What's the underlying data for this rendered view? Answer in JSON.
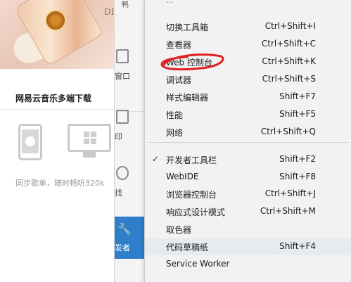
{
  "page": {
    "brand_text": "DI",
    "section_title": "网易云音乐多端下载",
    "sync_text": "同步歌单，随时畅听320k"
  },
  "strip": {
    "top_label": "鸭",
    "items": [
      {
        "label": "窗口",
        "icon": "window-icon"
      },
      {
        "label": "印",
        "icon": "print-icon"
      },
      {
        "label": "找",
        "icon": "search-icon"
      }
    ],
    "active_label": "发者",
    "active_icon": "wrench-icon"
  },
  "menu": {
    "top_text": "...",
    "items": [
      {
        "label": "切换工具箱",
        "shortcut": "Ctrl+Shift+I",
        "checked": false
      },
      {
        "label": "查看器",
        "shortcut": "Ctrl+Shift+C",
        "checked": false
      },
      {
        "label": "Web 控制台",
        "shortcut": "Ctrl+Shift+K",
        "checked": false,
        "annotated": true
      },
      {
        "label": "调试器",
        "shortcut": "Ctrl+Shift+S",
        "checked": false
      },
      {
        "label": "样式编辑器",
        "shortcut": "Shift+F7",
        "checked": false
      },
      {
        "label": "性能",
        "shortcut": "Shift+F5",
        "checked": false
      },
      {
        "label": "网络",
        "shortcut": "Ctrl+Shift+Q",
        "checked": false
      },
      {
        "label": "开发者工具栏",
        "shortcut": "Shift+F2",
        "checked": true
      },
      {
        "label": "WebIDE",
        "shortcut": "Shift+F8",
        "checked": false
      },
      {
        "label": "浏览器控制台",
        "shortcut": "Ctrl+Shift+J",
        "checked": false
      },
      {
        "label": "响应式设计模式",
        "shortcut": "Ctrl+Shift+M",
        "checked": false
      },
      {
        "label": "取色器",
        "shortcut": "",
        "checked": false
      },
      {
        "label": "代码草稿纸",
        "shortcut": "Shift+F4",
        "checked": false,
        "hover": true
      },
      {
        "label": "Service Worker",
        "shortcut": "",
        "checked": false
      }
    ],
    "check_glyph": "✓",
    "annotation_color": "#e02020",
    "hover_color": "#e7eaef"
  }
}
